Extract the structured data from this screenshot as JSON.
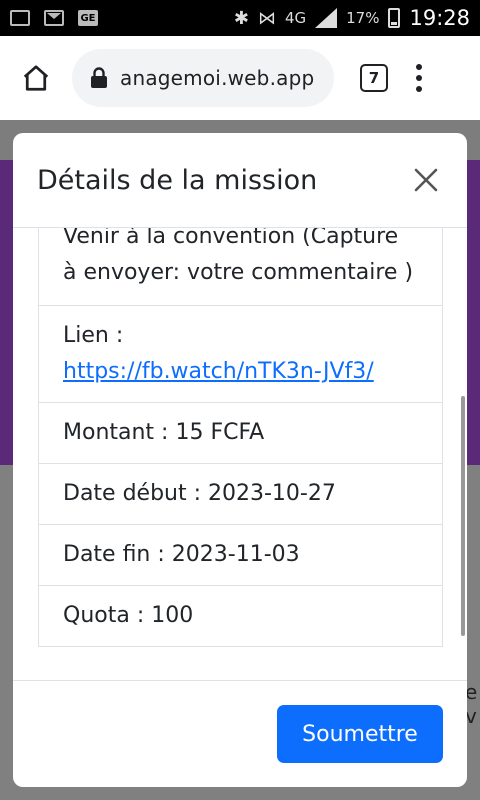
{
  "status_bar": {
    "network": "4G",
    "battery": "17%",
    "time": "19:28"
  },
  "browser": {
    "url": "anagemoi.web.app",
    "tab_count": "7"
  },
  "page": {
    "side_text": "e v"
  },
  "modal": {
    "title": "Détails de la mission",
    "items": [
      {
        "text": "Venir à la convention (Capture à envoyer: votre commentaire )"
      },
      {
        "label": "Lien :",
        "link": "https://fb.watch/nTK3n-JVf3/"
      },
      {
        "text": "Montant : 15 FCFA"
      },
      {
        "text": "Date début : 2023-10-27"
      },
      {
        "text": "Date fin : 2023-11-03"
      },
      {
        "text": "Quota : 100"
      }
    ],
    "submit_label": "Soumettre"
  }
}
